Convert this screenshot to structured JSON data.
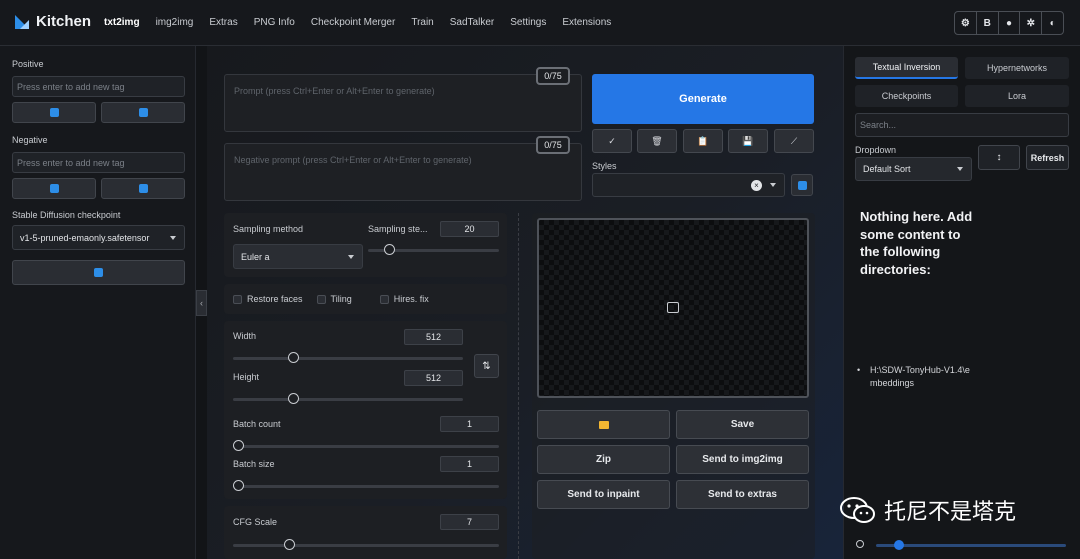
{
  "header": {
    "app_name": "Kitchen",
    "tabs": [
      "txt2img",
      "img2img",
      "Extras",
      "PNG Info",
      "Checkpoint Merger",
      "Train",
      "SadTalker",
      "Settings",
      "Extensions"
    ],
    "active_tab": "txt2img",
    "tools": [
      "gear-icon",
      "B",
      "github-icon",
      "settings-icon",
      "theme-icon"
    ],
    "tools_b_label": "B"
  },
  "left": {
    "positive_label": "Positive",
    "positive_placeholder": "Press enter to add new tag",
    "negative_label": "Negative",
    "negative_placeholder": "Press enter to add new tag",
    "checkpoint_label": "Stable Diffusion checkpoint",
    "checkpoint_value": "v1-5-pruned-emaonly.safetensor"
  },
  "prompt": {
    "placeholder": "Prompt (press Ctrl+Enter or Alt+Enter to generate)",
    "counter": "0/75"
  },
  "negative_prompt": {
    "placeholder": "Negative prompt (press Ctrl+Enter or Alt+Enter to generate)",
    "counter": "0/75"
  },
  "generate_label": "Generate",
  "styles_label": "Styles",
  "sampling": {
    "method_label": "Sampling method",
    "method_value": "Euler a",
    "steps_label": "Sampling ste...",
    "steps_value": "20",
    "steps_level": 0.13
  },
  "options": {
    "restore_faces": "Restore faces",
    "tiling": "Tiling",
    "hires_fix": "Hires. fix"
  },
  "dims": {
    "width_label": "Width",
    "width_value": "512",
    "width_level": 0.25,
    "height_label": "Height",
    "height_value": "512",
    "height_level": 0.25
  },
  "batch": {
    "count_label": "Batch count",
    "count_value": "1",
    "count_level": 0,
    "size_label": "Batch size",
    "size_value": "1",
    "size_level": 0
  },
  "cfg": {
    "label": "CFG Scale",
    "value": "7",
    "level": 0.2
  },
  "output_buttons": {
    "save": "Save",
    "zip": "Zip",
    "send_img2img": "Send to img2img",
    "send_inpaint": "Send to inpaint",
    "send_extras": "Send to extras"
  },
  "right": {
    "tabs": [
      "Textual Inversion",
      "Hypernetworks",
      "Checkpoints",
      "Lora"
    ],
    "search_placeholder": "Search...",
    "dropdown_label": "Dropdown",
    "sort_value": "Default Sort",
    "refresh_label": "Refresh",
    "empty_message": "Nothing here. Add some content to the following directories:",
    "directory": "H:\\SDW-TonyHub-V1.4\\embeddings"
  },
  "watermark": "托尼不是塔克",
  "colors": {
    "accent": "#2577e6",
    "icon_blue": "#2d8ee8"
  }
}
